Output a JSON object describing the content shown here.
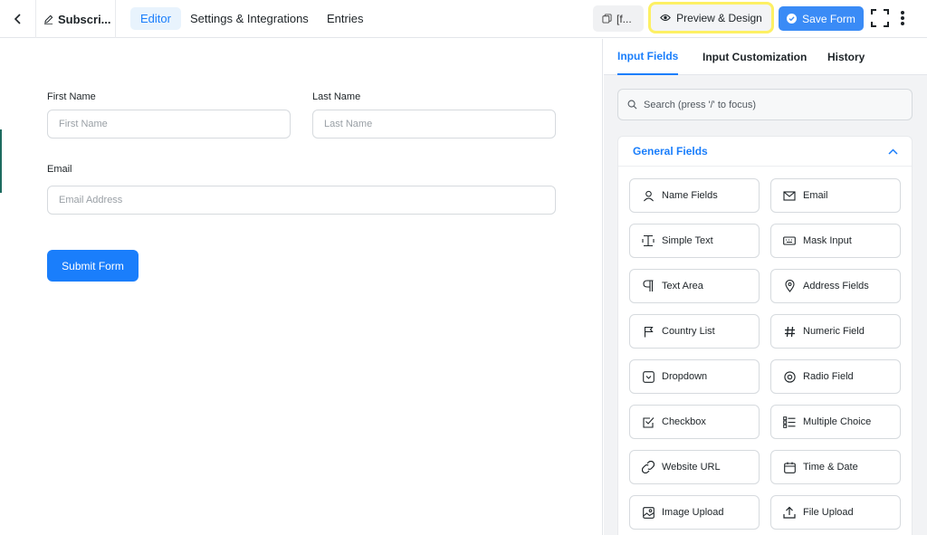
{
  "topbar": {
    "form_title": "Subscri...",
    "tabs": [
      {
        "label": "Editor",
        "active": true
      },
      {
        "label": "Settings & Integrations",
        "active": false
      },
      {
        "label": "Entries",
        "active": false
      }
    ],
    "shortcode_label": "[f...",
    "preview_label": "Preview & Design",
    "save_label": "Save Form"
  },
  "form": {
    "first_name_label": "First Name",
    "first_name_placeholder": "First Name",
    "last_name_label": "Last Name",
    "last_name_placeholder": "Last Name",
    "email_label": "Email",
    "email_placeholder": "Email Address",
    "submit_label": "Submit Form"
  },
  "panel": {
    "tabs": [
      {
        "label": "Input Fields",
        "active": true
      },
      {
        "label": "Input Customization",
        "active": false
      },
      {
        "label": "History",
        "active": false
      }
    ],
    "search_placeholder": "Search (press '/' to focus)",
    "section_title": "General Fields",
    "fields": [
      {
        "label": "Name Fields",
        "icon": "user-icon"
      },
      {
        "label": "Email",
        "icon": "envelope-icon"
      },
      {
        "label": "Simple Text",
        "icon": "text-cursor-icon"
      },
      {
        "label": "Mask Input",
        "icon": "keyboard-icon"
      },
      {
        "label": "Text Area",
        "icon": "paragraph-icon"
      },
      {
        "label": "Address Fields",
        "icon": "map-pin-icon"
      },
      {
        "label": "Country List",
        "icon": "flag-icon"
      },
      {
        "label": "Numeric Field",
        "icon": "hash-icon"
      },
      {
        "label": "Dropdown",
        "icon": "dropdown-icon"
      },
      {
        "label": "Radio Field",
        "icon": "radio-icon"
      },
      {
        "label": "Checkbox",
        "icon": "checkbox-icon"
      },
      {
        "label": "Multiple Choice",
        "icon": "list-icon"
      },
      {
        "label": "Website URL",
        "icon": "link-icon"
      },
      {
        "label": "Time & Date",
        "icon": "calendar-icon"
      },
      {
        "label": "Image Upload",
        "icon": "image-icon"
      },
      {
        "label": "File Upload",
        "icon": "upload-icon"
      }
    ]
  },
  "colors": {
    "accent": "#1a7efb",
    "highlight": "#fdf064",
    "panel_bg": "#f2f3f5"
  }
}
